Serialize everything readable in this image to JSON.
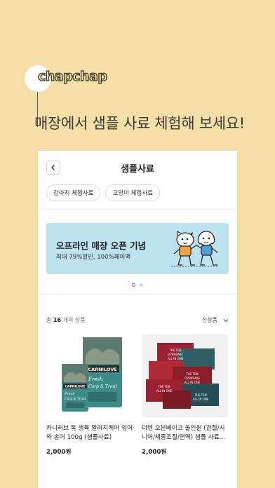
{
  "promo": {
    "logo_text": "chapchap",
    "headline": "매장에서 샘플 사료 체험해 보세요!"
  },
  "app": {
    "title": "샘플사료",
    "chips": [
      "강아지 체험사료",
      "고양이 체험사료"
    ],
    "banner": {
      "title": "오프라인 매장 오픈 기념",
      "subtitle": "최대 79%할인, 100%페이백"
    },
    "carousel": {
      "count": 2,
      "active_index": 0
    },
    "list": {
      "count_prefix": "총 ",
      "count_value": "16",
      "count_suffix": " 개의 상품",
      "sort_label": "신상품"
    },
    "products": [
      {
        "name": "카니러브 독 생육 알러지케어 잉어와 송어 100g (샘플사료)",
        "price": "2,000원",
        "brand_text": "CARNILOVE",
        "flavor_text": "Fresh Carp & Trout"
      },
      {
        "name": "더텐 오븐베이크 올인원 (관절/시니어/체중조절/면역) 샘플 사료…",
        "price": "2,000원",
        "brand_text": "THE TEN OVENBAKE ALL IN ONE"
      }
    ]
  },
  "colors": {
    "background": "#f5dfa6",
    "banner": "#bde2f0",
    "dot_active": "#e0463a",
    "carnilove_teal": "#3d8c8a",
    "theten_red": "#9b2030"
  }
}
